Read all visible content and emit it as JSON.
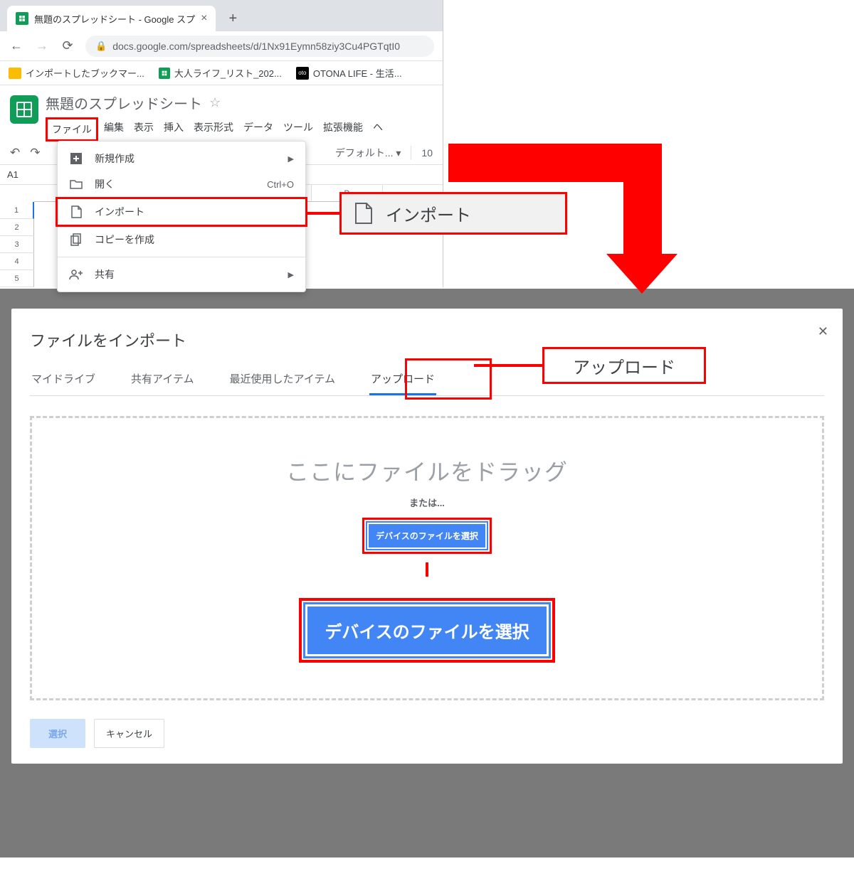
{
  "browser": {
    "tab_title": "無題のスプレッドシート - Google スプ",
    "url": "docs.google.com/spreadsheets/d/1Nx91Eymn58ziy3Cu4PGTqtI0",
    "bookmarks": [
      {
        "label": "インポートしたブックマー..."
      },
      {
        "label": "大人ライフ_リスト_202..."
      },
      {
        "label": "OTONA LIFE - 生活..."
      }
    ]
  },
  "sheets": {
    "doc_title": "無題のスプレッドシート",
    "menu": {
      "file": "ファイル",
      "edit": "編集",
      "view": "表示",
      "insert": "挿入",
      "format": "表示形式",
      "data": "データ",
      "tools": "ツール",
      "extensions": "拡張機能",
      "help": "ヘ"
    },
    "toolbar": {
      "font_option": "デフォルト...",
      "font_size": "10"
    },
    "name_box": "A1",
    "col_headers": [
      "D"
    ],
    "row_headers": [
      "1",
      "2",
      "3",
      "4",
      "5"
    ],
    "file_menu": {
      "new": "新規作成",
      "open": "開く",
      "open_shortcut": "Ctrl+O",
      "import": "インポート",
      "copy": "コピーを作成",
      "share": "共有"
    }
  },
  "callouts": {
    "import_label": "インポート",
    "upload_label": "アップロード",
    "device_big": "デバイスのファイルを選択"
  },
  "dialog": {
    "title": "ファイルをインポート",
    "tabs": {
      "my_drive": "マイドライブ",
      "shared": "共有アイテム",
      "recent": "最近使用したアイテム",
      "upload": "アップロード"
    },
    "drag_text": "ここにファイルをドラッグ",
    "or_text": "または...",
    "device_button": "デバイスのファイルを選択",
    "footer": {
      "select": "選択",
      "cancel": "キャンセル"
    }
  }
}
